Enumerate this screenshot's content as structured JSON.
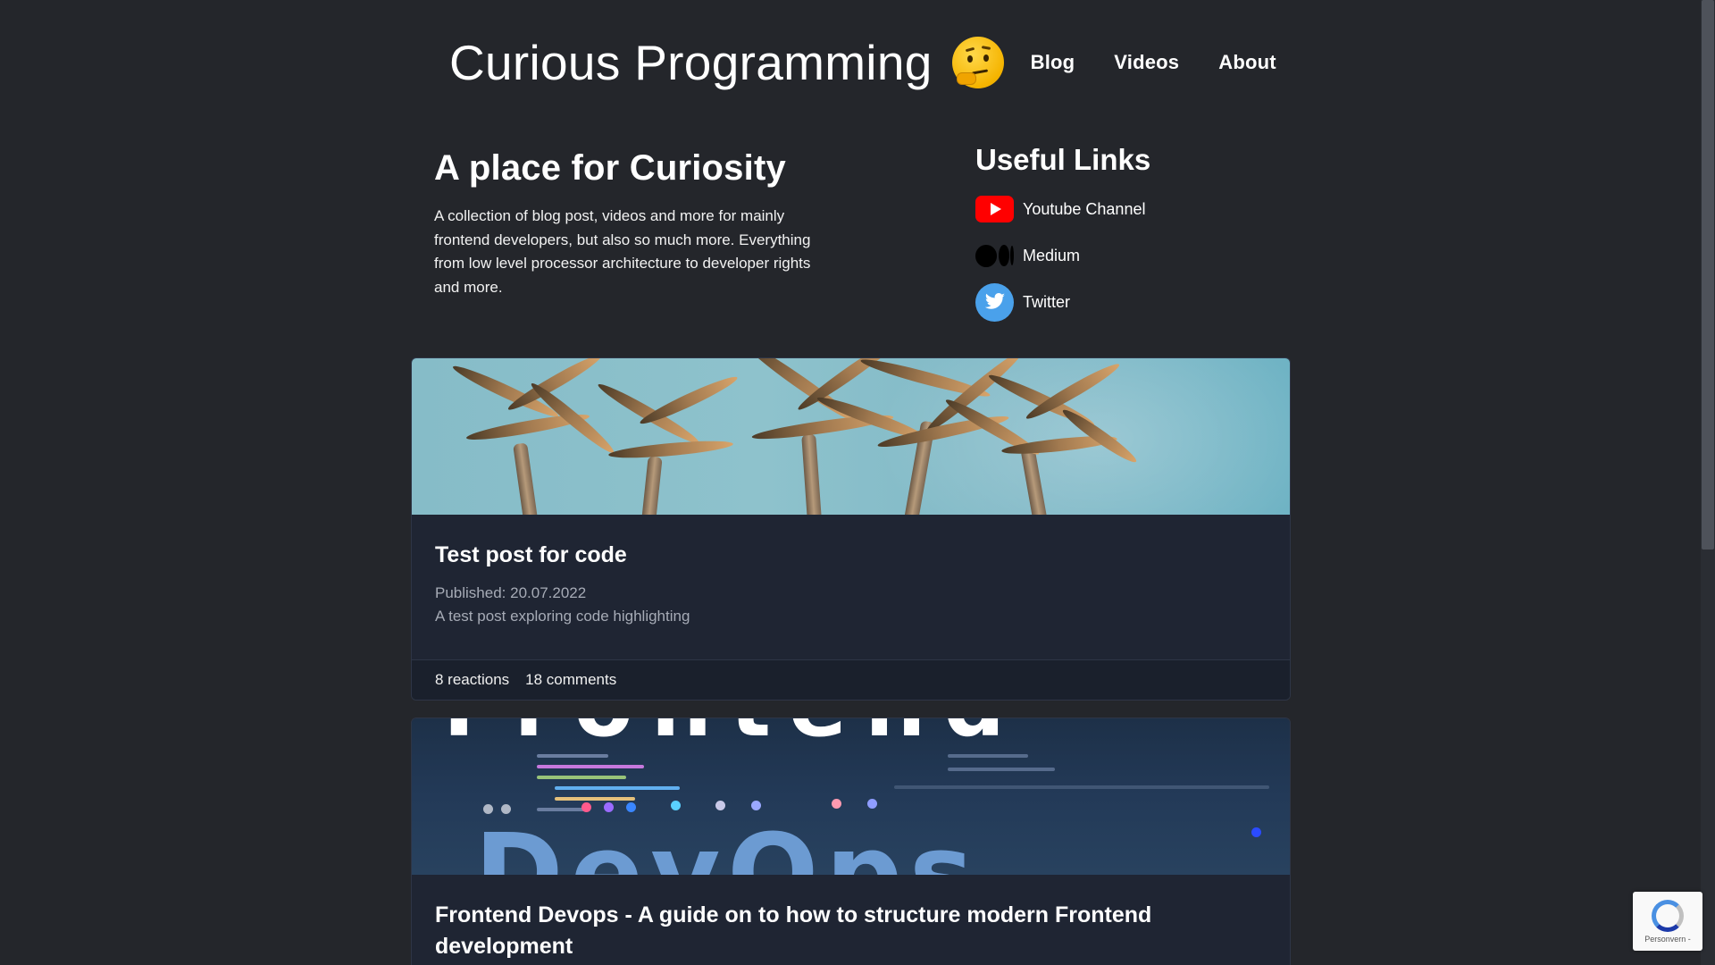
{
  "header": {
    "site_title": "Curious Programming",
    "emoji": "thinking-face-emoji",
    "nav": [
      "Blog",
      "Videos",
      "About"
    ]
  },
  "intro": {
    "heading": "A place for Curiosity",
    "description": "A collection of blog post, videos and more for mainly frontend developers, but also so much more. Everything from low level processor architecture to developer rights and more."
  },
  "useful_links": {
    "heading": "Useful Links",
    "items": [
      {
        "label": "Youtube Channel",
        "icon": "youtube-icon"
      },
      {
        "label": "Medium",
        "icon": "medium-icon"
      },
      {
        "label": "Twitter",
        "icon": "twitter-icon"
      }
    ]
  },
  "posts": [
    {
      "title": "Test post for code",
      "published": "Published: 20.07.2022",
      "description": "A test post exploring code highlighting",
      "reactions": "8 reactions",
      "comments": "18 comments",
      "image": "palm-trees-image"
    },
    {
      "title": "Frontend Devops - A guide on to how to structure modern Frontend development",
      "image": "code-screen-image",
      "image_text_top": "Frontend",
      "image_text_bottom": "DevOps"
    }
  ],
  "recaptcha": {
    "label": "Personvern -"
  },
  "colors": {
    "background": "#24262b",
    "card": "#1f2533",
    "youtube": "#ff0000",
    "twitter": "#4aa1eb"
  }
}
